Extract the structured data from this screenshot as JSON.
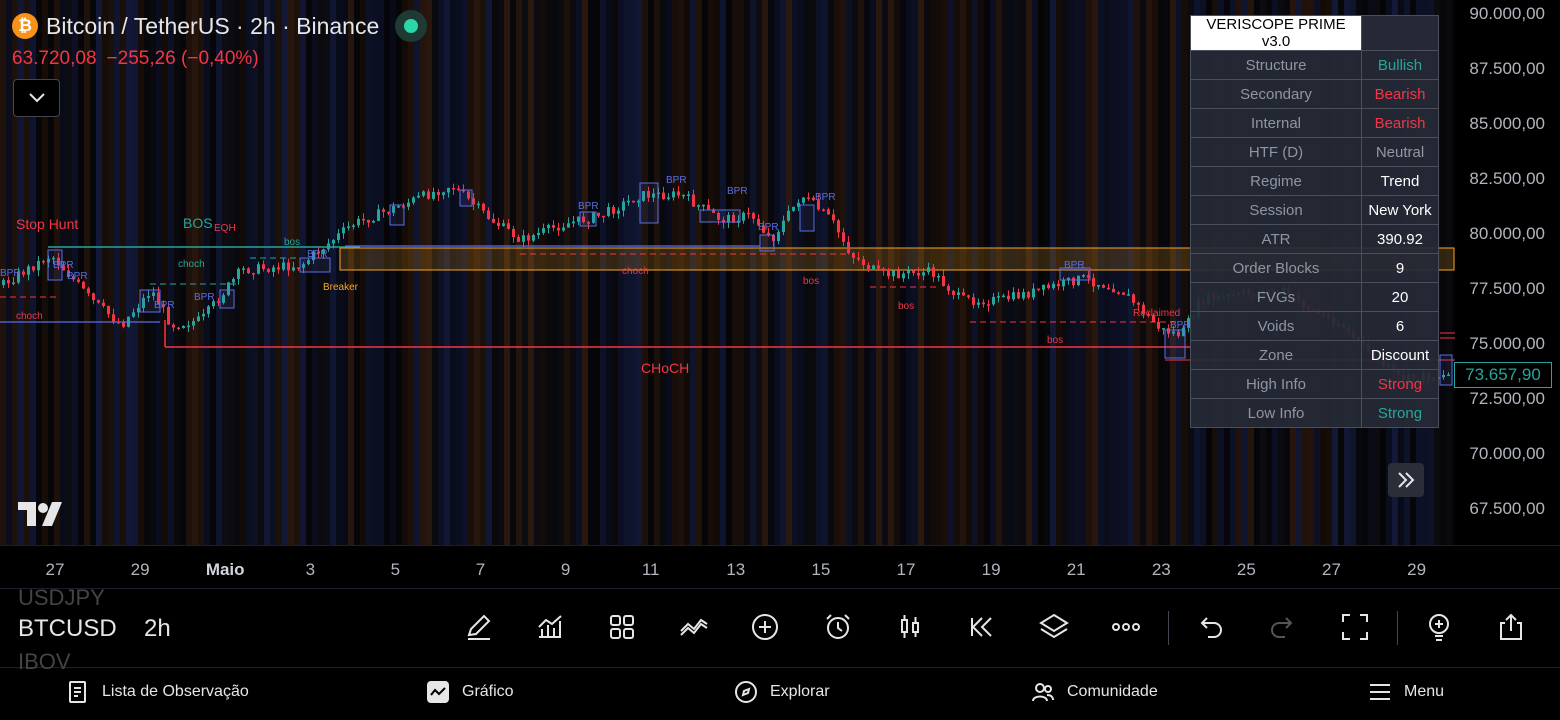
{
  "header": {
    "symbol_logo": "₿",
    "title": "Bitcoin / TetherUS · 2h · Binance",
    "last_price": "63.720,08",
    "change": "−255,26 (−0,40%)"
  },
  "indicator_table": {
    "title": "VERISCOPE PRIME v3.0",
    "rows": [
      {
        "label": "Structure",
        "value": "Bullish",
        "color": "#26a69a"
      },
      {
        "label": "Secondary",
        "value": "Bearish",
        "color": "#f23645"
      },
      {
        "label": "Internal",
        "value": "Bearish",
        "color": "#f23645"
      },
      {
        "label": "HTF (D)",
        "value": "Neutral",
        "color": "#9598a1"
      },
      {
        "label": "Regime",
        "value": "Trend",
        "color": "#ffffff"
      },
      {
        "label": "Session",
        "value": "New York",
        "color": "#ffffff"
      },
      {
        "label": "ATR",
        "value": "390.92",
        "color": "#ffffff"
      },
      {
        "label": "Order Blocks",
        "value": "9",
        "color": "#ffffff"
      },
      {
        "label": "FVGs",
        "value": "20",
        "color": "#ffffff"
      },
      {
        "label": "Voids",
        "value": "6",
        "color": "#ffffff"
      },
      {
        "label": "Zone",
        "value": "Discount",
        "color": "#ffffff"
      },
      {
        "label": "High Info",
        "value": "Strong",
        "color": "#f23645"
      },
      {
        "label": "Low Info",
        "value": "Strong",
        "color": "#26a69a"
      }
    ]
  },
  "price_scale": {
    "labels": [
      "90.000,00",
      "87.500,00",
      "85.000,00",
      "82.500,00",
      "80.000,00",
      "77.500,00",
      "75.000,00",
      "72.500,00",
      "70.000,00",
      "67.500,00"
    ],
    "current_price": "73.657,90"
  },
  "date_axis": {
    "labels": [
      "27",
      "29",
      "Maio",
      "3",
      "5",
      "7",
      "9",
      "11",
      "13",
      "15",
      "17",
      "19",
      "21",
      "23",
      "25",
      "27",
      "29"
    ]
  },
  "chart_labels": {
    "stop_hunt": "Stop Hunt",
    "bos_big": "BOS",
    "eqh": "EQH",
    "bos_small": "bos",
    "choch_small": "choch",
    "choch_big": "CHoCH",
    "bpr": "BPR",
    "breaker": "Breaker",
    "reclaimed": "Reclaimed"
  },
  "toolbar": {
    "ticker_above": "USDJPY",
    "ticker": "BTCUSD",
    "ticker_below": "IBOV",
    "interval": "2h"
  },
  "nav": {
    "watchlist": "Lista de Observação",
    "chart": "Gráfico",
    "explore": "Explorar",
    "community": "Comunidade",
    "menu": "Menu"
  },
  "colors": {
    "up": "#26a69a",
    "down": "#f23645",
    "bpr": "#5b6ee1",
    "zone": "#f5a623"
  },
  "icons": [
    "pencil-icon",
    "indicators-icon",
    "templates-icon",
    "compare-icon",
    "add-icon",
    "alert-icon",
    "candles-icon",
    "replay-icon",
    "layers-icon",
    "more-icon",
    "undo-icon",
    "redo-icon",
    "fullscreen-icon",
    "ideas-icon",
    "share-icon"
  ]
}
